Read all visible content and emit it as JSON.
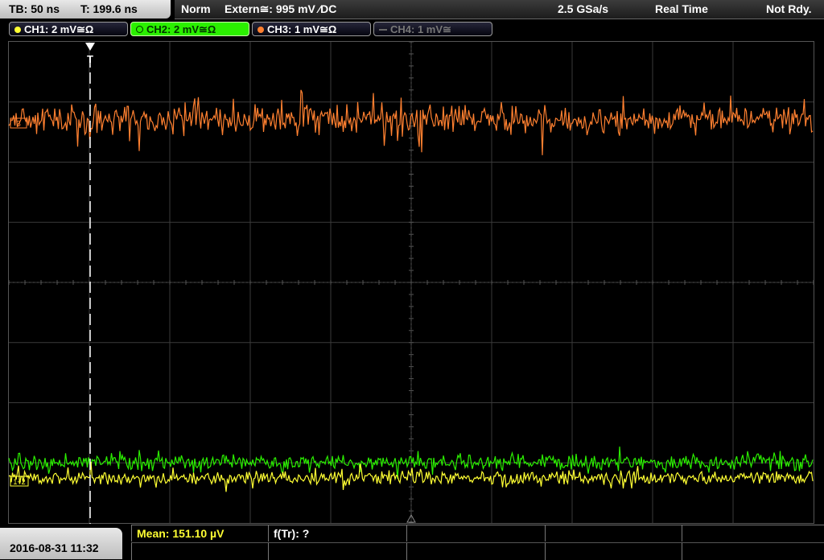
{
  "top_bar": {
    "timebase": "TB: 50 ns",
    "trigger_time": "T: 199.6 ns",
    "trigger_mode": "Norm",
    "trigger_source": "Extern≅: 995 mV ⁄DC",
    "sample_rate": "2.5 GSa/s",
    "acquisition_mode": "Real Time",
    "status": "Not Rdy."
  },
  "channels": [
    {
      "label": "CH1: 2 mV≅Ω",
      "color": "#ffff33",
      "active": true
    },
    {
      "label": "CH2: 2 mV≅Ω",
      "color": "#2bf000",
      "active": true,
      "selected": true
    },
    {
      "label": "CH3: 1 mV≅Ω",
      "color": "#ff8030",
      "active": true
    },
    {
      "label": "CH4: 1 mV≅",
      "color": "#777777",
      "active": false
    }
  ],
  "markers": {
    "trigger_label": "T",
    "ch3_offset": "3",
    "ch12_offset": "1+2"
  },
  "measurements": {
    "mean": "Mean: 151.10 µV",
    "frequency": "f(Tr): ?"
  },
  "timestamp": "2016-08-31 11:32"
}
